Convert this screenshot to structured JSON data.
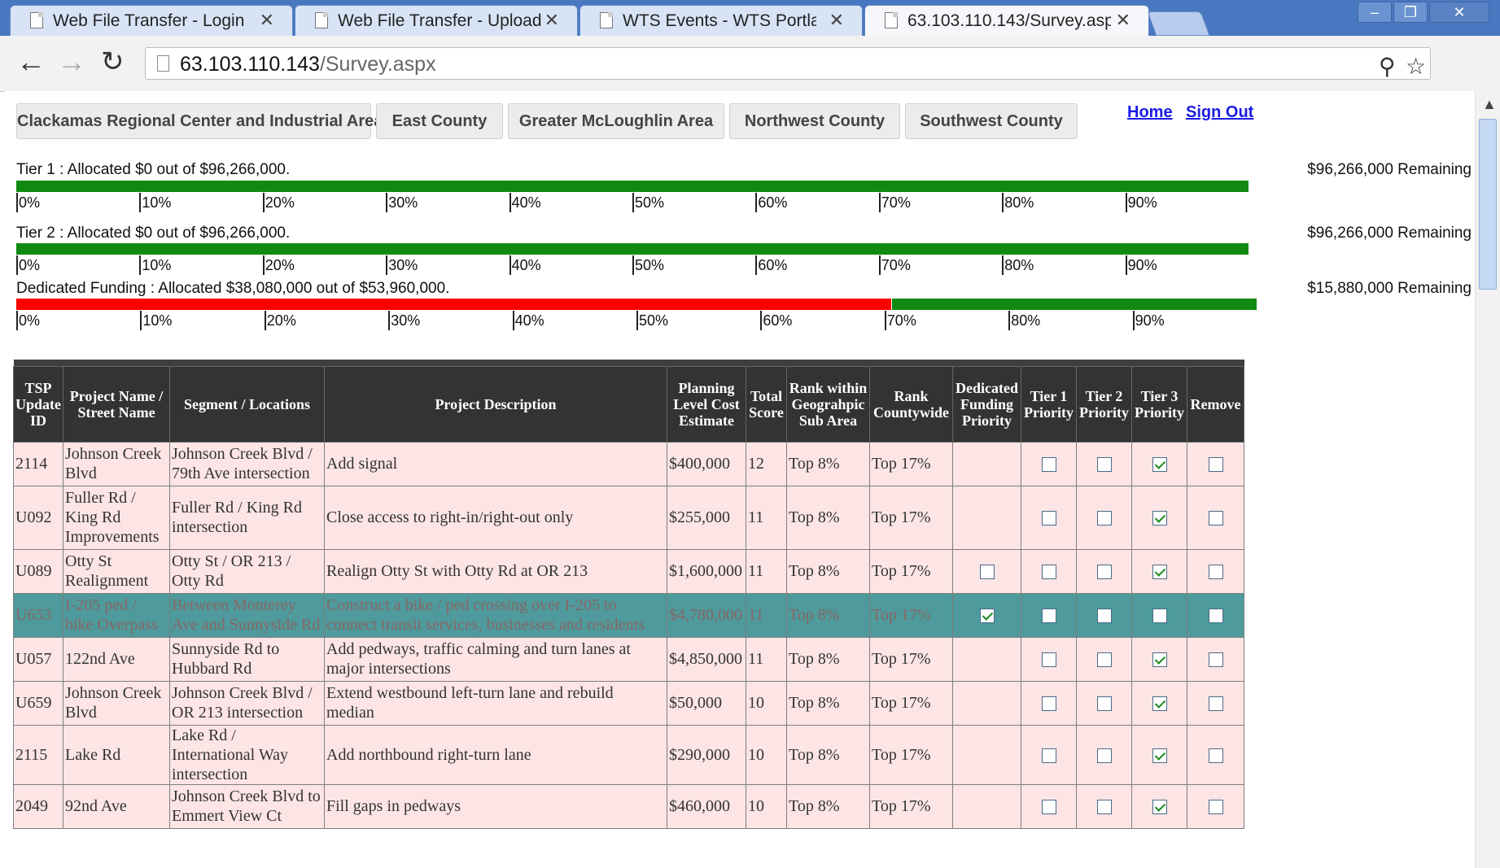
{
  "browser": {
    "tabs": [
      {
        "title": "Web File Transfer - Login",
        "active": false
      },
      {
        "title": "Web File Transfer - Upload",
        "active": false
      },
      {
        "title": "WTS Events - WTS Portland",
        "active": false
      },
      {
        "title": "63.103.110.143/Survey.asp",
        "active": true
      }
    ],
    "url_host": "63.103.110.143",
    "url_path": "/Survey.aspx",
    "window_controls": {
      "minimize": "–",
      "maximize": "❐",
      "close": "✕"
    }
  },
  "areas": [
    "Clackamas Regional Center and Industrial Area",
    "East County",
    "Greater McLoughlin Area",
    "Northwest County",
    "Southwest County"
  ],
  "links": {
    "home": "Home",
    "signout": "Sign Out"
  },
  "tiers": [
    {
      "label": "Tier 1 : Allocated  $0  out of  $96,266,000.",
      "remaining": "$96,266,000 Remaining",
      "allocated_fraction": 0
    },
    {
      "label": "Tier 2 : Allocated $0  out of  $96,266,000.",
      "remaining": "$96,266,000 Remaining",
      "allocated_fraction": 0
    },
    {
      "label": "Dedicated Funding : Allocated  $38,080,000  out of  $53,960,000.",
      "remaining": "$15,880,000 Remaining",
      "allocated_fraction": 0.7057
    }
  ],
  "ticks": [
    "0%",
    "10%",
    "20%",
    "30%",
    "40%",
    "50%",
    "60%",
    "70%",
    "80%",
    "90%"
  ],
  "table": {
    "headers": [
      "TSP Update ID",
      "Project Name / Street Name",
      "Segment / Locations",
      "Project Description",
      "Planning Level Cost Estimate",
      "Total Score",
      "Rank within Geograhpic Sub Area",
      "Rank Countywide",
      "Dedicated Funding Priority",
      "Tier 1 Priority",
      "Tier 2 Priority",
      "Tier 3 Priority",
      "Remove"
    ],
    "rows": [
      {
        "id": "2114",
        "name": "Johnson Creek Blvd",
        "segment": "Johnson Creek Blvd / 79th Ave intersection",
        "desc": "Add signal",
        "cost": "$400,000",
        "score": "12",
        "rank_sub": "Top 8%",
        "rank_county": "Top 17%",
        "dedicated": null,
        "tier1": false,
        "tier2": false,
        "tier3": true,
        "remove": false,
        "selected": false
      },
      {
        "id": "U092",
        "name": "Fuller Rd / King Rd Improvements",
        "segment": "Fuller Rd / King Rd intersection",
        "desc": "Close access to right-in/right-out only",
        "cost": "$255,000",
        "score": "11",
        "rank_sub": "Top 8%",
        "rank_county": "Top 17%",
        "dedicated": null,
        "tier1": false,
        "tier2": false,
        "tier3": true,
        "remove": false,
        "selected": false
      },
      {
        "id": "U089",
        "name": "Otty St Realignment",
        "segment": "Otty St / OR 213 / Otty Rd",
        "desc": "Realign Otty St with Otty Rd at OR 213",
        "cost": "$1,600,000",
        "score": "11",
        "rank_sub": "Top 8%",
        "rank_county": "Top 17%",
        "dedicated": false,
        "tier1": false,
        "tier2": false,
        "tier3": true,
        "remove": false,
        "selected": false
      },
      {
        "id": "U653",
        "name": "I-205 ped / bike Overpass",
        "segment": "Between Monterey Ave and Sunnyside Rd",
        "desc": "Construct a bike / ped crossing over I-205 to connect transit services, businesses and residents",
        "cost": "$4,780,000",
        "score": "11",
        "rank_sub": "Top 8%",
        "rank_county": "Top 17%",
        "dedicated": true,
        "tier1": false,
        "tier2": false,
        "tier3": false,
        "remove": false,
        "selected": true
      },
      {
        "id": "U057",
        "name": "122nd Ave",
        "segment": "Sunnyside Rd to Hubbard Rd",
        "desc": "Add pedways, traffic calming and turn lanes at major intersections",
        "cost": "$4,850,000",
        "score": "11",
        "rank_sub": "Top 8%",
        "rank_county": "Top 17%",
        "dedicated": null,
        "tier1": false,
        "tier2": false,
        "tier3": true,
        "remove": false,
        "selected": false
      },
      {
        "id": "U659",
        "name": "Johnson Creek Blvd",
        "segment": "Johnson Creek Blvd / OR 213 intersection",
        "desc": "Extend westbound left-turn lane and rebuild median",
        "cost": "$50,000",
        "score": "10",
        "rank_sub": "Top 8%",
        "rank_county": "Top 17%",
        "dedicated": null,
        "tier1": false,
        "tier2": false,
        "tier3": true,
        "remove": false,
        "selected": false
      },
      {
        "id": "2115",
        "name": "Lake Rd",
        "segment": "Lake Rd / International Way intersection",
        "desc": "Add northbound right-turn lane",
        "cost": "$290,000",
        "score": "10",
        "rank_sub": "Top 8%",
        "rank_county": "Top 17%",
        "dedicated": null,
        "tier1": false,
        "tier2": false,
        "tier3": true,
        "remove": false,
        "selected": false
      },
      {
        "id": "2049",
        "name": "92nd Ave",
        "segment": "Johnson Creek Blvd to Emmert View Ct",
        "desc": "Fill gaps in pedways",
        "cost": "$460,000",
        "score": "10",
        "rank_sub": "Top 8%",
        "rank_county": "Top 17%",
        "dedicated": null,
        "tier1": false,
        "tier2": false,
        "tier3": true,
        "remove": false,
        "selected": false
      }
    ]
  }
}
